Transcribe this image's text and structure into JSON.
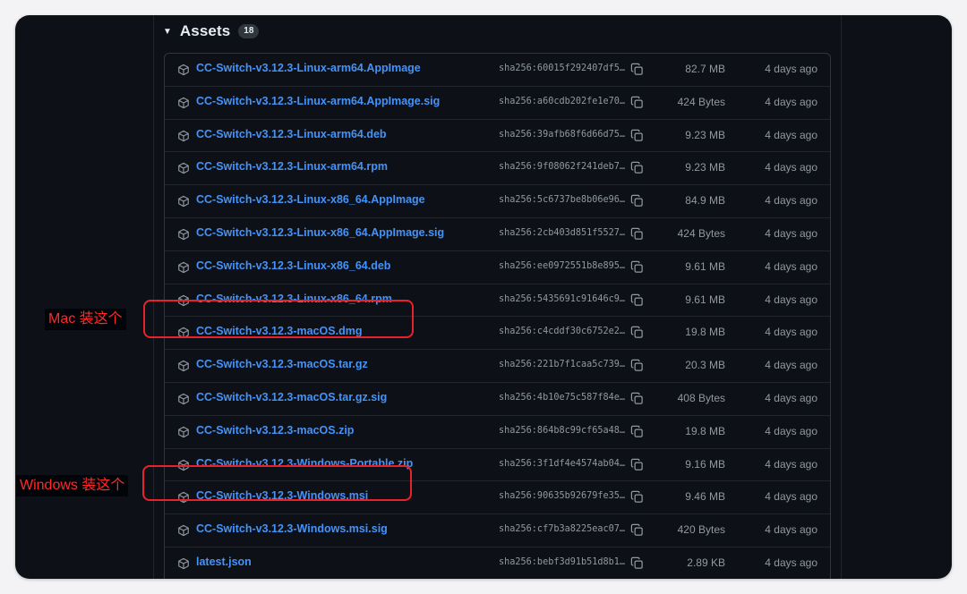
{
  "assets": {
    "title": "Assets",
    "count": "18"
  },
  "annotations": {
    "mac_label": "Mac 装这个",
    "windows_label": "Windows 装这个"
  },
  "icons": {
    "package": "package-icon",
    "copy": "copy-icon",
    "caret": "triangle-down-icon"
  },
  "colors": {
    "link": "#4493f8",
    "highlight": "#e8222b",
    "background": "#0d1117"
  },
  "files": [
    {
      "name": "CC-Switch-v3.12.3-Linux-arm64.AppImage",
      "sha": "sha256:60015f292407df5…",
      "size": "82.7 MB",
      "date": "4 days ago"
    },
    {
      "name": "CC-Switch-v3.12.3-Linux-arm64.AppImage.sig",
      "sha": "sha256:a60cdb202fe1e70…",
      "size": "424 Bytes",
      "date": "4 days ago"
    },
    {
      "name": "CC-Switch-v3.12.3-Linux-arm64.deb",
      "sha": "sha256:39afb68f6d66d75…",
      "size": "9.23 MB",
      "date": "4 days ago"
    },
    {
      "name": "CC-Switch-v3.12.3-Linux-arm64.rpm",
      "sha": "sha256:9f08062f241deb7…",
      "size": "9.23 MB",
      "date": "4 days ago"
    },
    {
      "name": "CC-Switch-v3.12.3-Linux-x86_64.AppImage",
      "sha": "sha256:5c6737be8b06e96…",
      "size": "84.9 MB",
      "date": "4 days ago"
    },
    {
      "name": "CC-Switch-v3.12.3-Linux-x86_64.AppImage.sig",
      "sha": "sha256:2cb403d851f5527…",
      "size": "424 Bytes",
      "date": "4 days ago"
    },
    {
      "name": "CC-Switch-v3.12.3-Linux-x86_64.deb",
      "sha": "sha256:ee0972551b8e895…",
      "size": "9.61 MB",
      "date": "4 days ago"
    },
    {
      "name": "CC-Switch-v3.12.3-Linux-x86_64.rpm",
      "sha": "sha256:5435691c91646c9…",
      "size": "9.61 MB",
      "date": "4 days ago"
    },
    {
      "name": "CC-Switch-v3.12.3-macOS.dmg",
      "sha": "sha256:c4cddf30c6752e2…",
      "size": "19.8 MB",
      "date": "4 days ago"
    },
    {
      "name": "CC-Switch-v3.12.3-macOS.tar.gz",
      "sha": "sha256:221b7f1caa5c739…",
      "size": "20.3 MB",
      "date": "4 days ago"
    },
    {
      "name": "CC-Switch-v3.12.3-macOS.tar.gz.sig",
      "sha": "sha256:4b10e75c587f84e…",
      "size": "408 Bytes",
      "date": "4 days ago"
    },
    {
      "name": "CC-Switch-v3.12.3-macOS.zip",
      "sha": "sha256:864b8c99cf65a48…",
      "size": "19.8 MB",
      "date": "4 days ago"
    },
    {
      "name": "CC-Switch-v3.12.3-Windows-Portable.zip",
      "sha": "sha256:3f1df4e4574ab04…",
      "size": "9.16 MB",
      "date": "4 days ago"
    },
    {
      "name": "CC-Switch-v3.12.3-Windows.msi",
      "sha": "sha256:90635b92679fe35…",
      "size": "9.46 MB",
      "date": "4 days ago"
    },
    {
      "name": "CC-Switch-v3.12.3-Windows.msi.sig",
      "sha": "sha256:cf7b3a8225eac07…",
      "size": "420 Bytes",
      "date": "4 days ago"
    },
    {
      "name": "latest.json",
      "sha": "sha256:bebf3d91b51d8b1…",
      "size": "2.89 KB",
      "date": "4 days ago"
    }
  ]
}
